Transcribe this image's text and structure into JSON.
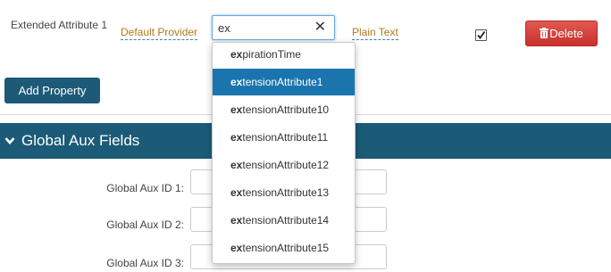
{
  "property_row": {
    "name": "Extended Attribute 1",
    "provider": "Default Provider",
    "search_value": "ex",
    "clear_icon": "close-icon",
    "data_type": "Plain Text",
    "checkbox_checked": true,
    "delete_label": "Delete"
  },
  "add_property_label": "Add Property",
  "section": {
    "title": "Global Aux Fields"
  },
  "aux_fields": [
    {
      "label": "Global Aux ID 1:"
    },
    {
      "label": "Global Aux ID 2:"
    },
    {
      "label": "Global Aux ID 3:"
    }
  ],
  "dropdown": {
    "match_prefix": "ex",
    "items": [
      {
        "match": "ex",
        "rest": "pirationTime"
      },
      {
        "match": "ex",
        "rest": "tensionAttribute1"
      },
      {
        "match": "ex",
        "rest": "tensionAttribute10"
      },
      {
        "match": "ex",
        "rest": "tensionAttribute11"
      },
      {
        "match": "ex",
        "rest": "tensionAttribute12"
      },
      {
        "match": "ex",
        "rest": "tensionAttribute13"
      },
      {
        "match": "ex",
        "rest": "tensionAttribute14"
      },
      {
        "match": "ex",
        "rest": "tensionAttribute15"
      }
    ],
    "active_index": 1
  },
  "colors": {
    "header_bg": "#1b5b77",
    "add_button_bg": "#1c5a77",
    "delete_button_bg": "#d9534f",
    "active_item_bg": "#1a74ad",
    "link_color": "#b07a18"
  }
}
